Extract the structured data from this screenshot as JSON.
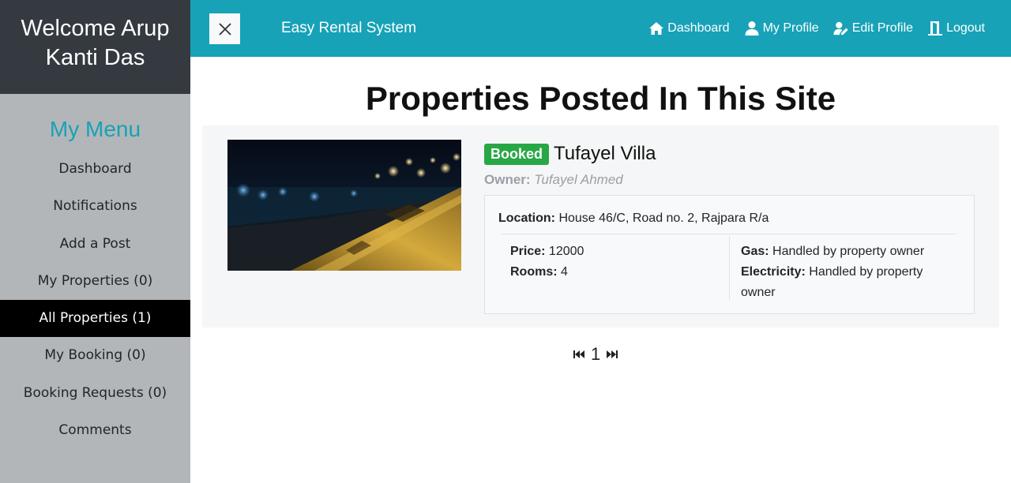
{
  "sidebar": {
    "welcome": "Welcome Arup Kanti Das",
    "menu_title": "My Menu",
    "items": [
      {
        "label": "Dashboard"
      },
      {
        "label": "Notifications"
      },
      {
        "label": "Add a Post"
      },
      {
        "label": "My Properties (0)"
      },
      {
        "label": "All Properties (1)",
        "active": true
      },
      {
        "label": "My Booking (0)"
      },
      {
        "label": "Booking Requests (0)"
      },
      {
        "label": "Comments"
      }
    ]
  },
  "topbar": {
    "close_icon": "close-icon",
    "brand": "Easy Rental System",
    "nav": [
      {
        "label": "Dashboard",
        "icon": "home-icon"
      },
      {
        "label": "My Profile",
        "icon": "user-icon"
      },
      {
        "label": "Edit Profile",
        "icon": "user-edit-icon"
      },
      {
        "label": "Logout",
        "icon": "door-exit-icon"
      }
    ]
  },
  "main": {
    "page_title": "Properties Posted In This Site",
    "listing": {
      "status": "Booked",
      "name": "Tufayel Villa",
      "owner_label": "Owner:",
      "owner_name": "Tufayel Ahmed",
      "location_label": "Location:",
      "location": "House 46/C, Road no. 2, Rajpara R/a",
      "price_label": "Price:",
      "price": "12000",
      "rooms_label": "Rooms:",
      "rooms": "4",
      "gas_label": "Gas:",
      "gas": "Handled by property owner",
      "electricity_label": "Electricity:",
      "electricity": "Handled by property owner"
    },
    "pagination": {
      "first_icon": "skip-back-icon",
      "current_page": "1",
      "last_icon": "skip-forward-icon"
    }
  },
  "colors": {
    "topbar": "#17a2b8",
    "sidebar_header": "#343a40",
    "sidebar": "#b3b6b8",
    "active_item": "#000000",
    "badge": "#28a745",
    "menu_title": "#17a2b8"
  }
}
